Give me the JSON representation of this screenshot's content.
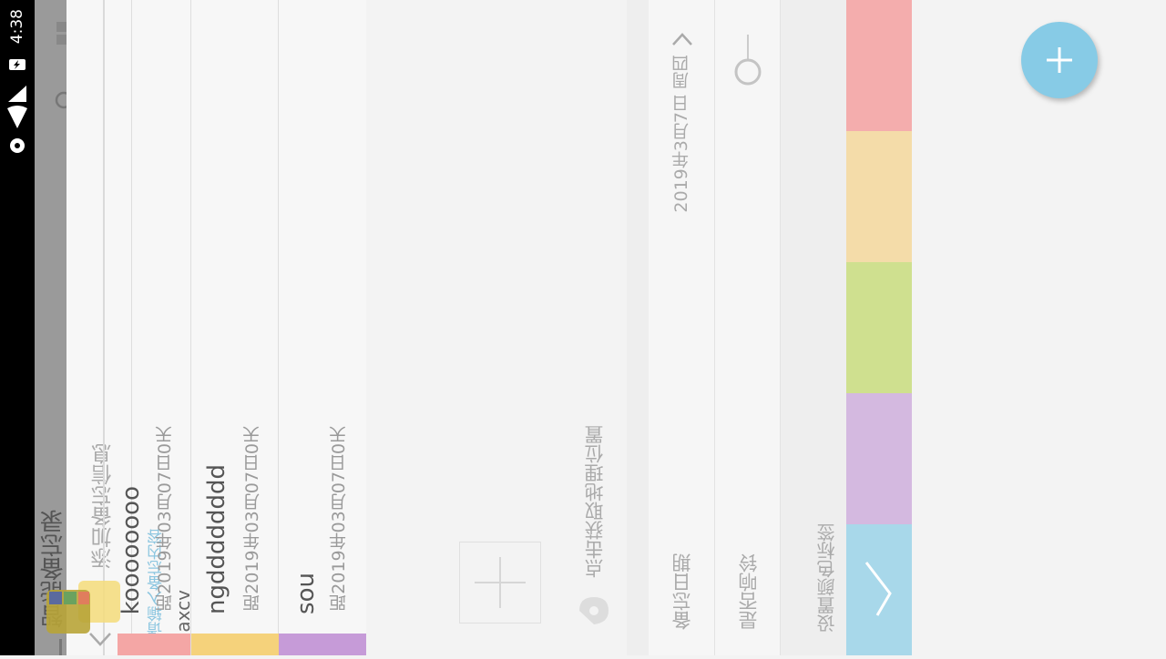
{
  "status": {
    "time": "4:38"
  },
  "toolbar": {
    "title": "智能备忘录"
  },
  "add_note": {
    "title": "添加备忘信息",
    "placeholder": "请输入备忘内容",
    "typed": "axcv"
  },
  "notes": [
    {
      "title": "koooooooo",
      "subtitle": "距2019年03月07日0天",
      "color": "#f4a6a5"
    },
    {
      "title": "ngdddddddd",
      "subtitle": "距2019年03月07日0天",
      "color": "#f5d27b"
    },
    {
      "title": "sou",
      "subtitle": "距2019年03月07日0天",
      "color": "#c69bd8"
    }
  ],
  "location": {
    "label": "点击获取地理位置"
  },
  "settings": {
    "date_label": "备忘日期",
    "date_value": "2019年3月7日 周四",
    "ring_label": "是否响铃",
    "color_label": "设置颜色标签"
  },
  "swatches": [
    "#f4adad",
    "#f4dca9",
    "#cfe08f",
    "#d4b9e0",
    "#a8d8ea"
  ],
  "colors": {
    "accent": "#87cbe6",
    "toolbar": "#9a9a9a",
    "statusbar": "#000000"
  },
  "icons": [
    "dashboard-icon",
    "search-icon",
    "chevron-right-icon",
    "menu-icon",
    "chevron-down-icon",
    "location-pin-icon",
    "add-icon"
  ]
}
